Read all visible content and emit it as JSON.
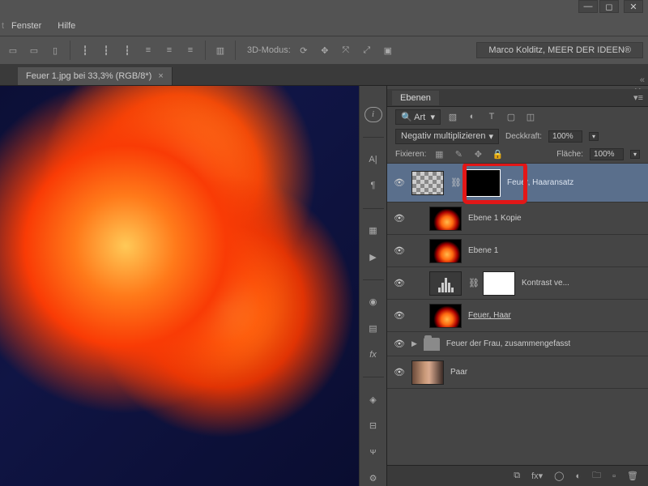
{
  "menu": {
    "fenster": "Fenster",
    "hilfe": "Hilfe"
  },
  "options_bar": {
    "mode_label": "3D-Modus:",
    "brand": "Marco Kolditz, MEER DER IDEEN®"
  },
  "document_tab": {
    "title": "Feuer 1.jpg bei 33,3% (RGB/8*)",
    "close": "×"
  },
  "layers_panel": {
    "title": "Ebenen",
    "filter_kind": "Art",
    "blend_mode": "Negativ multiplizieren",
    "opacity_label": "Deckkraft:",
    "opacity_value": "100%",
    "fill_label": "Fläche:",
    "fill_value": "100%",
    "lock_label": "Fixieren:",
    "layers": [
      {
        "name": "Feuer, Haaransatz",
        "selected": true,
        "has_mask": true
      },
      {
        "name": "Ebene 1 Kopie"
      },
      {
        "name": "Ebene 1"
      },
      {
        "name": "Kontrast ve...",
        "adjustment": true
      },
      {
        "name": "Feuer, Haar",
        "underlined": true
      },
      {
        "name": "Feuer der Frau, zusammengefasst",
        "group": true
      },
      {
        "name": "Paar"
      }
    ],
    "footer_fx": "fx"
  }
}
